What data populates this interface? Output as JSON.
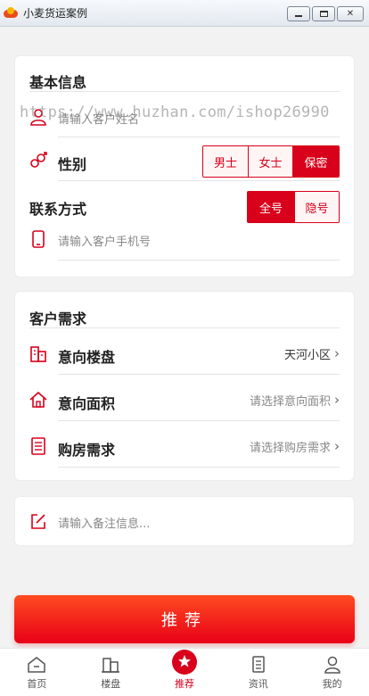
{
  "window": {
    "title": "小麦货运案例"
  },
  "watermark": "https://www.huzhan.com/ishop26990",
  "basic": {
    "title": "基本信息",
    "name_placeholder": "请输入客户姓名",
    "gender_label": "性别",
    "gender_options": [
      "男士",
      "女士",
      "保密"
    ],
    "gender_selected": "保密",
    "contact_label": "联系方式",
    "contact_options": [
      "全号",
      "隐号"
    ],
    "contact_selected": "全号",
    "phone_placeholder": "请输入客户手机号"
  },
  "demand": {
    "title": "客户需求",
    "rows": [
      {
        "label": "意向楼盘",
        "value": "天河小区"
      },
      {
        "label": "意向面积",
        "value": "请选择意向面积"
      },
      {
        "label": "购房需求",
        "value": "请选择购房需求"
      }
    ]
  },
  "notes": {
    "placeholder": "请输入备注信息..."
  },
  "recommend_button": "推荐",
  "tabs": [
    {
      "label": "首页",
      "icon": "home-icon"
    },
    {
      "label": "楼盘",
      "icon": "building-icon"
    },
    {
      "label": "推荐",
      "icon": "star-icon"
    },
    {
      "label": "资讯",
      "icon": "news-icon"
    },
    {
      "label": "我的",
      "icon": "user-icon"
    }
  ],
  "active_tab": "推荐",
  "colors": {
    "accent": "#d8001a",
    "button_top": "#ff4b20",
    "button_bottom": "#e90018"
  }
}
